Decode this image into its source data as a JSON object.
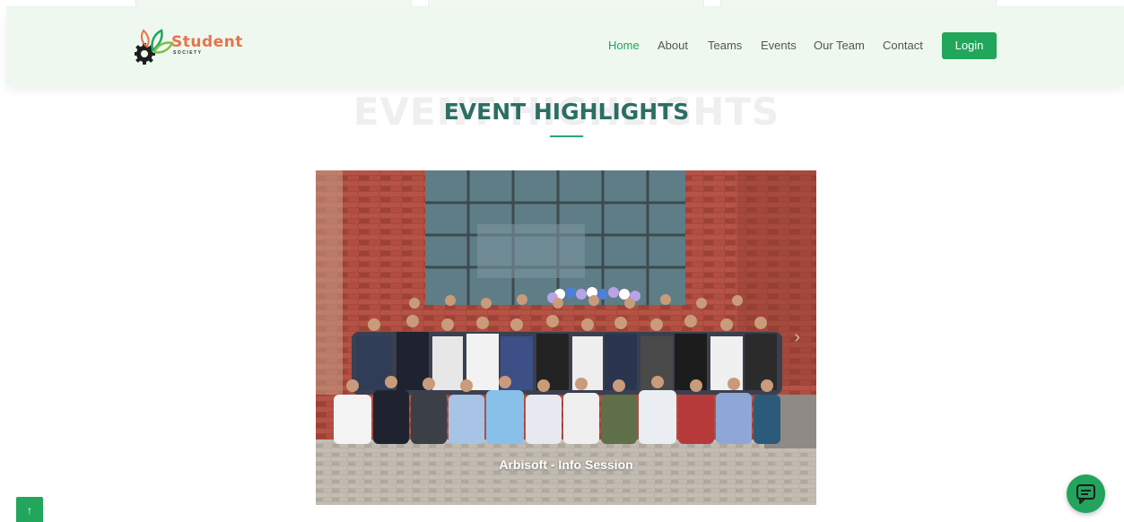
{
  "brand": {
    "name": "Student",
    "tagline": "SOCIETY"
  },
  "nav": {
    "items": [
      {
        "label": "Home",
        "active": true
      },
      {
        "label": "About",
        "active": false
      },
      {
        "label": "Teams",
        "active": false
      },
      {
        "label": "Events",
        "active": false
      },
      {
        "label": "Our Team",
        "active": false
      },
      {
        "label": "Contact",
        "active": false
      }
    ],
    "login_label": "Login"
  },
  "section": {
    "background_title": "EVENT HIGHLIGHTS",
    "title": "EVENT HIGHLIGHTS"
  },
  "carousel": {
    "caption": "Arbisoft - Info Session",
    "next_icon": "chevron-right-icon"
  },
  "floating": {
    "back_to_top_icon": "arrow-up-icon",
    "chat_icon": "chat-icon"
  },
  "colors": {
    "accent": "#21a65b",
    "brand_orange": "#e8734a",
    "title": "#2c6e64",
    "header_bg": "#eef8ee"
  }
}
